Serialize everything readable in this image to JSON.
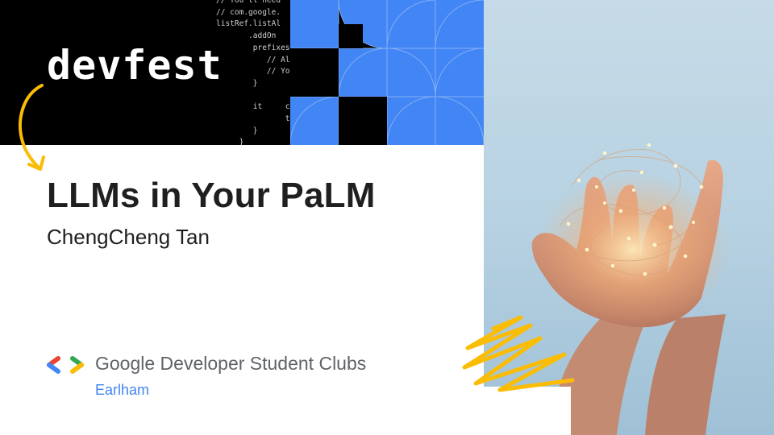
{
  "banner": {
    "logo_text": "devfest",
    "code_lines": [
      "// You'll need",
      "// com.google.",
      "listRef.listAl",
      "       .addOn",
      "        prefixes.fo",
      "           // All",
      "           // You",
      "        }",
      "",
      "        it     ch { item",
      "               the items",
      "        }",
      "     }"
    ]
  },
  "slide": {
    "title": "LLMs in Your PaLM",
    "speaker": "ChengCheng Tan"
  },
  "footer": {
    "org_name": "Google Developer Student Clubs",
    "chapter": "Earlham"
  },
  "colors": {
    "blue": "#4285f4",
    "yellow": "#fbbc04",
    "red": "#ea4335",
    "green": "#34a853",
    "black": "#000000",
    "title_text": "#1f1f1f",
    "org_text": "#5f6368"
  },
  "icons": [
    "gdsc-logo-icon",
    "curved-arrow-icon",
    "zigzag-scribble-icon",
    "blue-geometric-pattern",
    "hands-fairy-lights-photo"
  ]
}
